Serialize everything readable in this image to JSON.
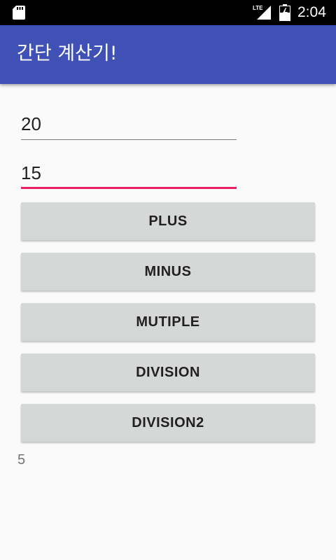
{
  "status_bar": {
    "time": "2:04",
    "network_label": "LTE",
    "icons": [
      "sd-card-icon",
      "signal-icon",
      "battery-charging-icon"
    ]
  },
  "app_bar": {
    "title": "간단 계산기!"
  },
  "inputs": {
    "first_value": "20",
    "second_value": "15"
  },
  "buttons": {
    "plus": "PLUS",
    "minus": "MINUS",
    "multiple": "MUTIPLE",
    "division": "DIVISION",
    "division2": "DIVISION2"
  },
  "result": "5",
  "colors": {
    "primary": "#3f51b5",
    "accent": "#e91e63",
    "status_bar": "#000000",
    "button": "#d6d7d7",
    "background": "#fafafa"
  }
}
